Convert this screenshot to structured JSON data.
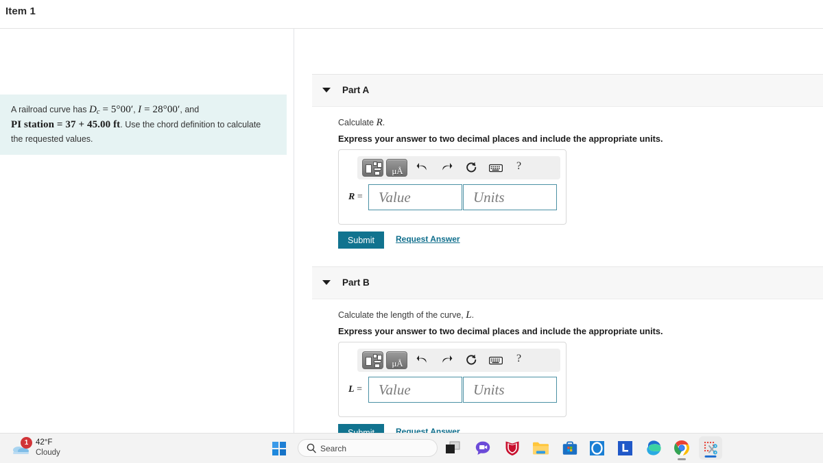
{
  "header": {
    "item_title": "Item 1"
  },
  "problem": {
    "line1_prefix": "A railroad curve has ",
    "dc_symbol": "D",
    "dc_sub": "c",
    "dc_value": " = 5°00′",
    "comma1": ", ",
    "i_symbol": "I",
    "i_value": " = 28°00′",
    "and_text": ", and",
    "line2_math": "PI station = 37 + 45.00 ft",
    "line2_tail": ". Use the chord definition to calculate",
    "line3": "the requested values."
  },
  "parts": [
    {
      "label": "Part A",
      "prompt_prefix": "Calculate ",
      "prompt_symbol": "R",
      "prompt_suffix": ".",
      "instruction": "Express your answer to two decimal places and include the appropriate units.",
      "eq_label": "R",
      "eq_equals": "=",
      "value_placeholder": "Value",
      "units_placeholder": "Units",
      "value_current": "",
      "units_current": "",
      "submit_label": "Submit",
      "request_label": "Request Answer"
    },
    {
      "label": "Part B",
      "prompt_prefix": "Calculate the length of the curve, ",
      "prompt_symbol": "L",
      "prompt_suffix": ".",
      "instruction": "Express your answer to two decimal places and include the appropriate units.",
      "eq_label": "L",
      "eq_equals": "=",
      "value_placeholder": "Value",
      "units_placeholder": "Units",
      "value_current": "",
      "units_current": "",
      "submit_label": "Submit",
      "request_label": "Request Answer"
    }
  ],
  "math_toolbar": {
    "template_button": "template-icon",
    "units_button_label": "μÅ",
    "undo_icon": "undo-arrow-icon",
    "redo_icon": "redo-arrow-icon",
    "reset_icon": "reset-circular-arrow-icon",
    "keyboard_icon": "keyboard-icon",
    "help_label": "?"
  },
  "taskbar": {
    "weather_temp": "42°F",
    "weather_desc": "Cloudy",
    "weather_badge": "1",
    "start_icon": "windows-start-icon",
    "search_placeholder": "Search",
    "search_icon": "search-icon",
    "icons": [
      {
        "name": "task-view-icon"
      },
      {
        "name": "chat-teams-icon"
      },
      {
        "name": "mcafee-shield-icon"
      },
      {
        "name": "file-explorer-icon"
      },
      {
        "name": "microsoft-store-icon"
      },
      {
        "name": "outlook-icon"
      },
      {
        "name": "linkedin-icon"
      },
      {
        "name": "microsoft-edge-icon"
      },
      {
        "name": "google-chrome-icon"
      },
      {
        "name": "snipping-tool-icon"
      }
    ]
  },
  "colors": {
    "accent": "#11738f",
    "link": "#0f6e8c",
    "problem_bg": "#e6f3f3",
    "field_border": "#4a90a4",
    "part_header_bg": "#f7f7f7"
  }
}
